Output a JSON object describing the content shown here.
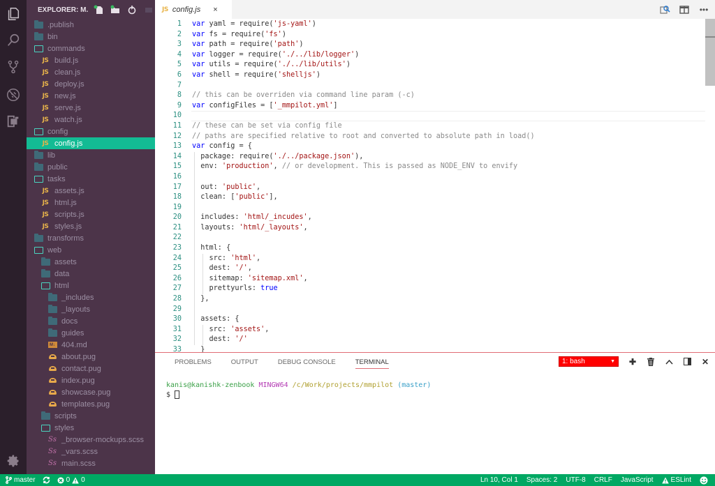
{
  "sidebar": {
    "title": "EXPLORER: M...",
    "actions": [
      "new-file",
      "new-folder",
      "refresh",
      "collapse-all"
    ],
    "tree": [
      {
        "label": ".publish",
        "type": "folder-closed",
        "depth": 0
      },
      {
        "label": "bin",
        "type": "folder-closed",
        "depth": 0
      },
      {
        "label": "commands",
        "type": "folder-open",
        "depth": 0
      },
      {
        "label": "build.js",
        "type": "js",
        "depth": 1
      },
      {
        "label": "clean.js",
        "type": "js",
        "depth": 1
      },
      {
        "label": "deploy.js",
        "type": "js",
        "depth": 1
      },
      {
        "label": "new.js",
        "type": "js",
        "depth": 1
      },
      {
        "label": "serve.js",
        "type": "js",
        "depth": 1
      },
      {
        "label": "watch.js",
        "type": "js",
        "depth": 1
      },
      {
        "label": "config",
        "type": "folder-open",
        "depth": 0
      },
      {
        "label": "config.js",
        "type": "js",
        "depth": 1,
        "active": true
      },
      {
        "label": "lib",
        "type": "folder-closed",
        "depth": 0
      },
      {
        "label": "public",
        "type": "folder-closed",
        "depth": 0
      },
      {
        "label": "tasks",
        "type": "folder-open",
        "depth": 0
      },
      {
        "label": "assets.js",
        "type": "js",
        "depth": 1
      },
      {
        "label": "html.js",
        "type": "js",
        "depth": 1
      },
      {
        "label": "scripts.js",
        "type": "js",
        "depth": 1
      },
      {
        "label": "styles.js",
        "type": "js",
        "depth": 1
      },
      {
        "label": "transforms",
        "type": "folder-closed",
        "depth": 0
      },
      {
        "label": "web",
        "type": "folder-open",
        "depth": 0
      },
      {
        "label": "assets",
        "type": "folder-closed",
        "depth": 1
      },
      {
        "label": "data",
        "type": "folder-closed",
        "depth": 1
      },
      {
        "label": "html",
        "type": "folder-open",
        "depth": 1
      },
      {
        "label": "_includes",
        "type": "folder-closed",
        "depth": 2
      },
      {
        "label": "_layouts",
        "type": "folder-closed",
        "depth": 2
      },
      {
        "label": "docs",
        "type": "folder-closed",
        "depth": 2
      },
      {
        "label": "guides",
        "type": "folder-closed",
        "depth": 2
      },
      {
        "label": "404.md",
        "type": "md",
        "depth": 2
      },
      {
        "label": "about.pug",
        "type": "pug",
        "depth": 2
      },
      {
        "label": "contact.pug",
        "type": "pug",
        "depth": 2
      },
      {
        "label": "index.pug",
        "type": "pug",
        "depth": 2
      },
      {
        "label": "showcase.pug",
        "type": "pug",
        "depth": 2
      },
      {
        "label": "templates.pug",
        "type": "pug",
        "depth": 2
      },
      {
        "label": "scripts",
        "type": "folder-closed",
        "depth": 1
      },
      {
        "label": "styles",
        "type": "folder-open",
        "depth": 1
      },
      {
        "label": "_browser-mockups.scss",
        "type": "scss",
        "depth": 2
      },
      {
        "label": "_vars.scss",
        "type": "scss",
        "depth": 2
      },
      {
        "label": "main.scss",
        "type": "scss",
        "depth": 2
      }
    ]
  },
  "editor": {
    "tab": {
      "label": "config.js",
      "icon": "JS",
      "close": "×"
    },
    "lines": [
      [
        [
          "kw",
          "var"
        ],
        [
          "t",
          " yaml = require("
        ],
        [
          "str",
          "'js-yaml'"
        ],
        [
          "t",
          ")"
        ]
      ],
      [
        [
          "kw",
          "var"
        ],
        [
          "t",
          " fs = require("
        ],
        [
          "str",
          "'fs'"
        ],
        [
          "t",
          ")"
        ]
      ],
      [
        [
          "kw",
          "var"
        ],
        [
          "t",
          " path = require("
        ],
        [
          "str",
          "'path'"
        ],
        [
          "t",
          ")"
        ]
      ],
      [
        [
          "kw",
          "var"
        ],
        [
          "t",
          " logger = require("
        ],
        [
          "str",
          "'./../lib/logger'"
        ],
        [
          "t",
          ")"
        ]
      ],
      [
        [
          "kw",
          "var"
        ],
        [
          "t",
          " utils = require("
        ],
        [
          "str",
          "'./../lib/utils'"
        ],
        [
          "t",
          ")"
        ]
      ],
      [
        [
          "kw",
          "var"
        ],
        [
          "t",
          " shell = require("
        ],
        [
          "str",
          "'shelljs'"
        ],
        [
          "t",
          ")"
        ]
      ],
      [],
      [
        [
          "cm",
          "// this can be overriden via command line param (-c)"
        ]
      ],
      [
        [
          "kw",
          "var"
        ],
        [
          "t",
          " configFiles = ["
        ],
        [
          "str",
          "'_mmpilot.yml'"
        ],
        [
          "t",
          "]"
        ]
      ],
      [],
      [
        [
          "cm",
          "// these can be set via config file"
        ]
      ],
      [
        [
          "cm",
          "// paths are specified relative to root and converted to absolute path in load()"
        ]
      ],
      [
        [
          "kw",
          "var"
        ],
        [
          "t",
          " config = {"
        ]
      ],
      [
        [
          "t",
          "  package: require("
        ],
        [
          "str",
          "'./../package.json'"
        ],
        [
          "t",
          "),"
        ]
      ],
      [
        [
          "t",
          "  env: "
        ],
        [
          "str",
          "'production'"
        ],
        [
          "t",
          ", "
        ],
        [
          "cm",
          "// or development. This is passed as NODE_ENV to envify"
        ]
      ],
      [],
      [
        [
          "t",
          "  out: "
        ],
        [
          "str",
          "'public'"
        ],
        [
          "t",
          ","
        ]
      ],
      [
        [
          "t",
          "  clean: ["
        ],
        [
          "str",
          "'public'"
        ],
        [
          "t",
          "],"
        ]
      ],
      [],
      [
        [
          "t",
          "  includes: "
        ],
        [
          "str",
          "'html/_incudes'"
        ],
        [
          "t",
          ","
        ]
      ],
      [
        [
          "t",
          "  layouts: "
        ],
        [
          "str",
          "'html/_layouts'"
        ],
        [
          "t",
          ","
        ]
      ],
      [],
      [
        [
          "t",
          "  html: {"
        ]
      ],
      [
        [
          "t",
          "    src: "
        ],
        [
          "str",
          "'html'"
        ],
        [
          "t",
          ","
        ]
      ],
      [
        [
          "t",
          "    dest: "
        ],
        [
          "str",
          "'/'"
        ],
        [
          "t",
          ","
        ]
      ],
      [
        [
          "t",
          "    sitemap: "
        ],
        [
          "str",
          "'sitemap.xml'"
        ],
        [
          "t",
          ","
        ]
      ],
      [
        [
          "t",
          "    prettyurls: "
        ],
        [
          "bool",
          "true"
        ]
      ],
      [
        [
          "t",
          "  },"
        ]
      ],
      [],
      [
        [
          "t",
          "  assets: {"
        ]
      ],
      [
        [
          "t",
          "    src: "
        ],
        [
          "str",
          "'assets'"
        ],
        [
          "t",
          ","
        ]
      ],
      [
        [
          "t",
          "    dest: "
        ],
        [
          "str",
          "'/'"
        ]
      ],
      [
        [
          "t",
          "  }"
        ]
      ]
    ],
    "current_line": 10
  },
  "panel": {
    "tabs": [
      "PROBLEMS",
      "OUTPUT",
      "DEBUG CONSOLE",
      "TERMINAL"
    ],
    "active_tab": "TERMINAL",
    "terminal_select": "1: bash",
    "terminal": {
      "user": "kanis@kanishk-zenbook",
      "host": "MINGW64",
      "path": "/c/Work/projects/mmpilot",
      "branch": "(master)",
      "prompt": "$"
    }
  },
  "statusbar": {
    "branch": "master",
    "errors": "0",
    "warnings": "0",
    "position": "Ln 10, Col 1",
    "spaces": "Spaces: 2",
    "encoding": "UTF-8",
    "eol": "CRLF",
    "language": "JavaScript",
    "linter": "ESLint"
  },
  "colors": {
    "status_bar": "#00a863",
    "sidebar_bg": "#4c3449",
    "active_file": "#13bb94",
    "terminal_select": "#ff0000"
  }
}
